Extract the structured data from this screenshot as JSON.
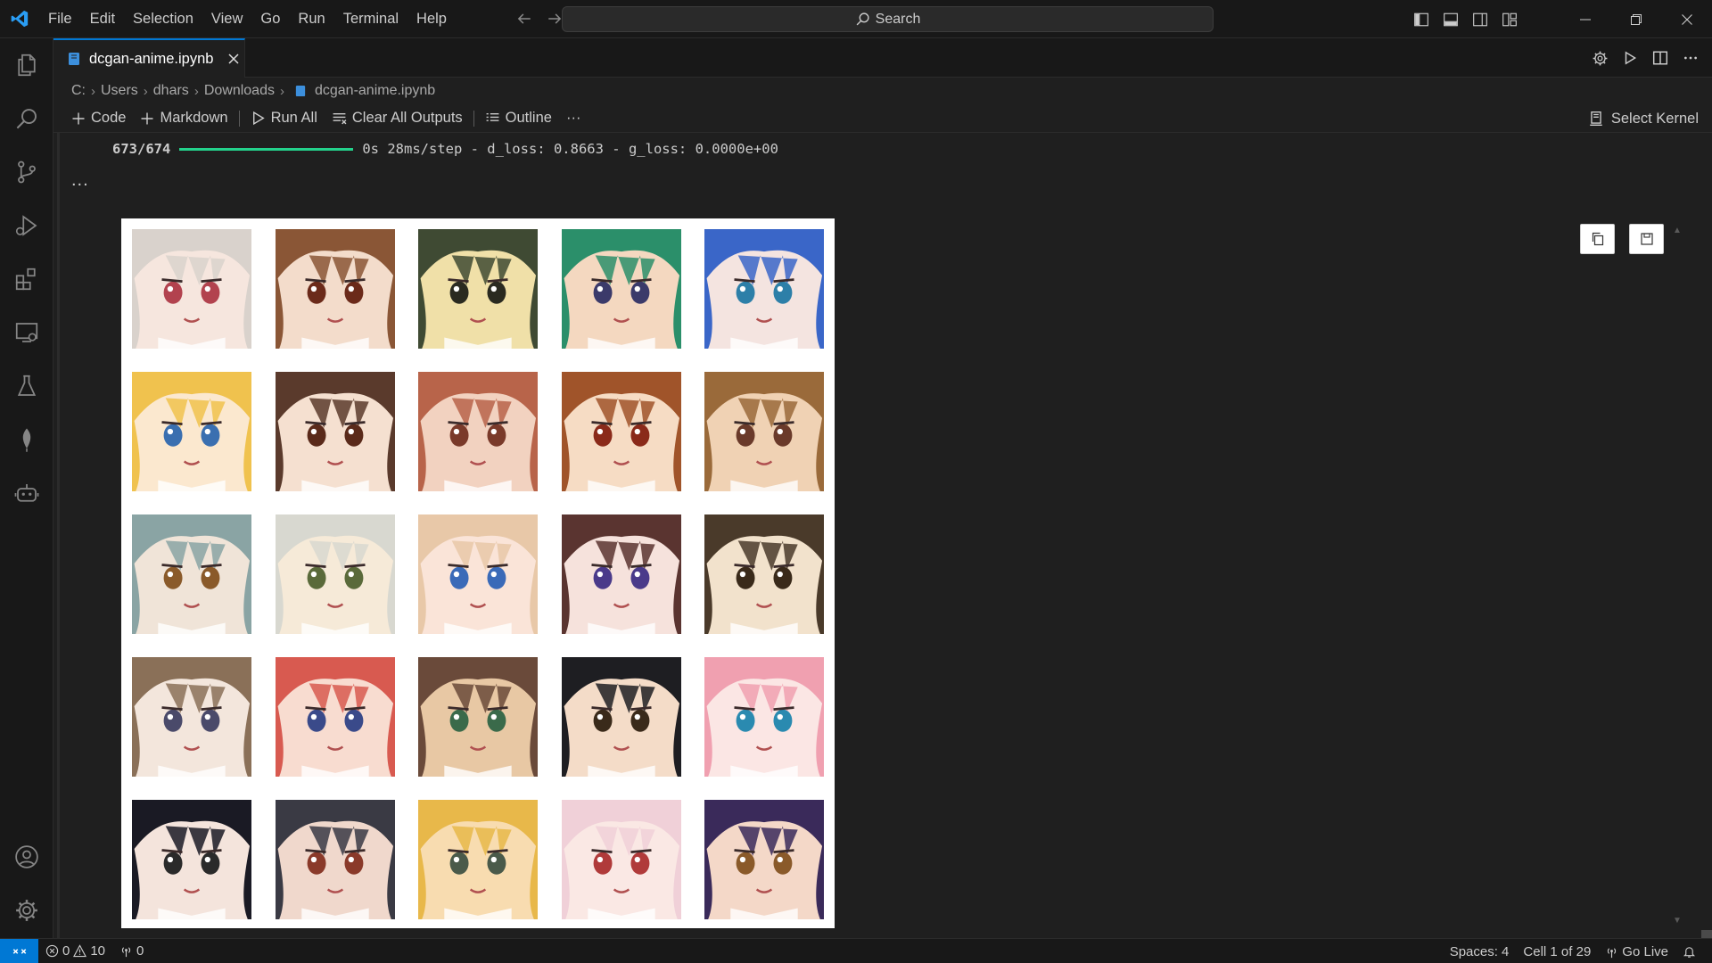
{
  "titlebar": {
    "menu": [
      "File",
      "Edit",
      "Selection",
      "View",
      "Go",
      "Run",
      "Terminal",
      "Help"
    ],
    "search_label": "Search"
  },
  "tab": {
    "filename": "dcgan-anime.ipynb"
  },
  "breadcrumbs": [
    "C:",
    "Users",
    "dhars",
    "Downloads",
    "dcgan-anime.ipynb"
  ],
  "toolbar": {
    "code_label": "Code",
    "markdown_label": "Markdown",
    "run_all_label": "Run All",
    "clear_outputs_label": "Clear All Outputs",
    "outline_label": "Outline",
    "more_label": "···",
    "select_kernel_label": "Select Kernel"
  },
  "output": {
    "progress_count": "673/674",
    "progress_value": 1.0,
    "progress_stats": "0s 28ms/step - d_loss: 0.8663 - g_loss: 0.0000e+00",
    "ellipsis": "...",
    "grid_rows": 5,
    "grid_cols": 5,
    "faces": [
      {
        "hair": "#d9d2cc",
        "skin": "#f6e6de",
        "eye": "#b2424e"
      },
      {
        "hair": "#8a5636",
        "skin": "#f3dccb",
        "eye": "#6b2a1a"
      },
      {
        "hair": "#3f4a33",
        "skin": "#f0e0a8",
        "eye": "#2a2a20"
      },
      {
        "hair": "#2b8f6a",
        "skin": "#f4d8c0",
        "eye": "#3b3a6a"
      },
      {
        "hair": "#3a66c8",
        "skin": "#f4e4e0",
        "eye": "#2d7fa8"
      },
      {
        "hair": "#f0c24e",
        "skin": "#fbe8cf",
        "eye": "#3a6fb0"
      },
      {
        "hair": "#5a3a2c",
        "skin": "#f5e0d0",
        "eye": "#5a2a1a"
      },
      {
        "hair": "#b8644a",
        "skin": "#f2d2c0",
        "eye": "#7a3a2a"
      },
      {
        "hair": "#a0542a",
        "skin": "#f6dcc4",
        "eye": "#8a2a1a"
      },
      {
        "hair": "#9a6a3a",
        "skin": "#f0d2b4",
        "eye": "#6a3a2a"
      },
      {
        "hair": "#8aa4a4",
        "skin": "#f0e4d8",
        "eye": "#8a5a2a"
      },
      {
        "hair": "#d8d8d0",
        "skin": "#f6ead8",
        "eye": "#5a6a3a"
      },
      {
        "hair": "#e8c8a8",
        "skin": "#fae4d8",
        "eye": "#3a6ab8"
      },
      {
        "hair": "#5a3430",
        "skin": "#f6e2dc",
        "eye": "#4a3a8a"
      },
      {
        "hair": "#4a3a2a",
        "skin": "#f2e2cc",
        "eye": "#3a2a1a"
      },
      {
        "hair": "#8a7058",
        "skin": "#f3e6dc",
        "eye": "#4a4a6a"
      },
      {
        "hair": "#d85a50",
        "skin": "#f8dcd0",
        "eye": "#3a4a8a"
      },
      {
        "hair": "#6a4a3a",
        "skin": "#e8c8a4",
        "eye": "#3a6a4a"
      },
      {
        "hair": "#1e1e22",
        "skin": "#f4dcc8",
        "eye": "#3a2a1a"
      },
      {
        "hair": "#f0a0b0",
        "skin": "#fbe6e4",
        "eye": "#2a8ab0"
      },
      {
        "hair": "#1a1a24",
        "skin": "#f4e4dc",
        "eye": "#2a2a2a"
      },
      {
        "hair": "#3a3a44",
        "skin": "#f0d8cc",
        "eye": "#8a3a2a"
      },
      {
        "hair": "#e8b84a",
        "skin": "#f8dcb0",
        "eye": "#4a5a4a"
      },
      {
        "hair": "#f0d0d8",
        "skin": "#fae8e4",
        "eye": "#b03a3a"
      },
      {
        "hair": "#3a2a5a",
        "skin": "#f4d8c8",
        "eye": "#8a5a2a"
      }
    ]
  },
  "statusbar": {
    "errors": "0",
    "warnings": "10",
    "ports": "0",
    "spaces": "Spaces: 4",
    "cell": "Cell 1 of 29",
    "go_live": "Go Live"
  },
  "colors": {
    "accent": "#0078d4",
    "progress": "#23d18b"
  }
}
